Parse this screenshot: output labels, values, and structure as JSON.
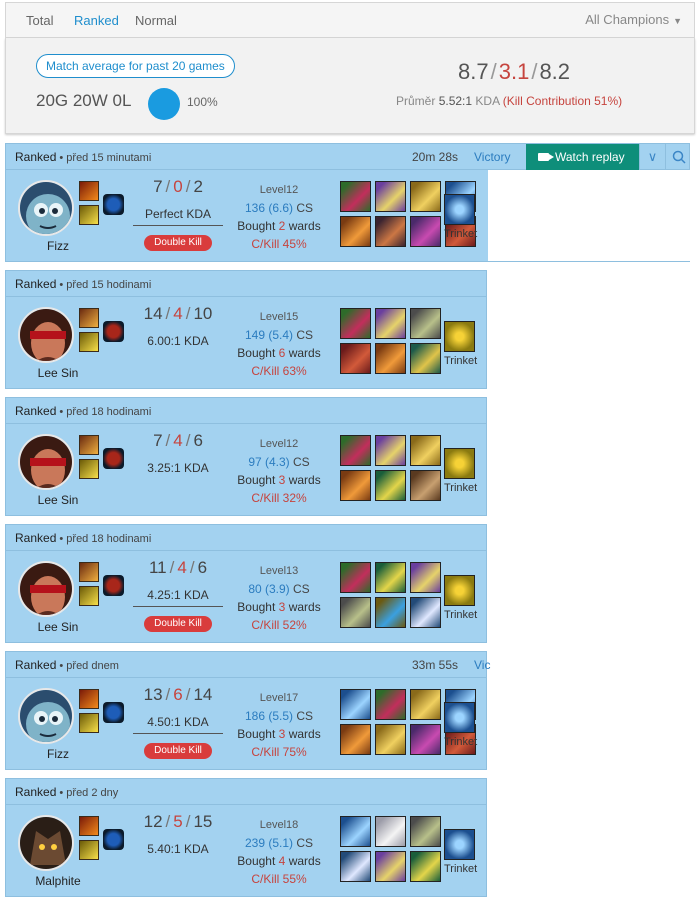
{
  "tabs": [
    {
      "label": "Total",
      "active": false
    },
    {
      "label": "Ranked",
      "active": true
    },
    {
      "label": "Normal",
      "active": false
    }
  ],
  "filter": {
    "label": "All Champions"
  },
  "summary": {
    "avg_label": "Match average for past 20 games",
    "record": "20G 20W 0L",
    "win_rate": "100%",
    "kda_k": "8.7",
    "kda_d": "3.1",
    "kda_a": "8.2",
    "sep": "/",
    "avg_label2": "Průměr",
    "kda_ratio": "5.52:1",
    "kda_word": "KDA",
    "kill_contribution": "(Kill Contribution 51%)"
  },
  "games": [
    {
      "type": "Ranked",
      "ago": "• před 15 minutami",
      "duration": "20m 28s",
      "result": "Victory",
      "champion": "Fizz",
      "portrait": "fizz",
      "spells": [
        "ignite",
        "flash"
      ],
      "rune": "blue",
      "k": "7",
      "d": "0",
      "a": "2",
      "ratio_value": "Perfect",
      "ratio_word": "KDA",
      "multikill": "Double Kill",
      "level": "Level12",
      "cs": "136 (6.6)",
      "cs_word": "CS",
      "wards_pre": "Bought",
      "wards_n": "2",
      "wards_post": "wards",
      "ckill": "C/Kill 45%",
      "items": [
        "green",
        "purple",
        "gold",
        "blue",
        "orange",
        "dark",
        "purple2",
        "red"
      ],
      "trinket": "blue",
      "trinket_label": "Trinket",
      "watch": "Watch replay",
      "show_watch": true
    },
    {
      "type": "Ranked",
      "ago": "• před 15 hodinami",
      "duration": "",
      "result": "",
      "champion": "Lee Sin",
      "portrait": "lee",
      "spells": [
        "smite",
        "flash"
      ],
      "rune": "red",
      "k": "14",
      "d": "4",
      "a": "10",
      "ratio_value": "6.00:1",
      "ratio_word": "KDA",
      "multikill": "",
      "level": "Level15",
      "cs": "149 (5.4)",
      "cs_word": "CS",
      "wards_pre": "Bought",
      "wards_n": "6",
      "wards_post": "wards",
      "ckill": "C/Kill 63%",
      "items": [
        "green",
        "purple",
        "gray",
        "yellow",
        "red",
        "orange",
        "teal"
      ],
      "trinket": "yellow",
      "trinket_label": "Trinket",
      "watch": "",
      "show_watch": false
    },
    {
      "type": "Ranked",
      "ago": "• před 18 hodinami",
      "duration": "",
      "result": "",
      "champion": "Lee Sin",
      "portrait": "lee",
      "spells": [
        "smite",
        "flash"
      ],
      "rune": "red",
      "k": "7",
      "d": "4",
      "a": "6",
      "ratio_value": "3.25:1",
      "ratio_word": "KDA",
      "multikill": "",
      "level": "Level12",
      "cs": "97 (4.3)",
      "cs_word": "CS",
      "wards_pre": "Bought",
      "wards_n": "3",
      "wards_post": "wards",
      "ckill": "C/Kill 32%",
      "items": [
        "green",
        "purple",
        "gold",
        "yellow",
        "orange",
        "green2",
        "brown"
      ],
      "trinket": "yellow",
      "trinket_label": "Trinket",
      "watch": "",
      "show_watch": false
    },
    {
      "type": "Ranked",
      "ago": "• před 18 hodinami",
      "duration": "",
      "result": "",
      "champion": "Lee Sin",
      "portrait": "lee",
      "spells": [
        "smite",
        "flash"
      ],
      "rune": "red",
      "k": "11",
      "d": "4",
      "a": "6",
      "ratio_value": "4.25:1",
      "ratio_word": "KDA",
      "multikill": "Double Kill",
      "level": "Level13",
      "cs": "80 (3.9)",
      "cs_word": "CS",
      "wards_pre": "Bought",
      "wards_n": "3",
      "wards_post": "wards",
      "ckill": "C/Kill 52%",
      "items": [
        "green",
        "green2",
        "purple",
        "yellow",
        "gray",
        "gold2",
        "blue2"
      ],
      "trinket": "yellow",
      "trinket_label": "Trinket",
      "watch": "",
      "show_watch": false
    },
    {
      "type": "Ranked",
      "ago": "• před dnem",
      "duration": "33m 55s",
      "result": "Vic",
      "champion": "Fizz",
      "portrait": "fizz",
      "spells": [
        "ignite",
        "flash"
      ],
      "rune": "blue",
      "k": "13",
      "d": "6",
      "a": "14",
      "ratio_value": "4.50:1",
      "ratio_word": "KDA",
      "multikill": "Double Kill",
      "level": "Level17",
      "cs": "186 (5.5)",
      "cs_word": "CS",
      "wards_pre": "Bought",
      "wards_n": "3",
      "wards_post": "wards",
      "ckill": "C/Kill 75%",
      "items": [
        "blue",
        "green",
        "gold",
        "blue",
        "orange",
        "gold",
        "purple2",
        "red"
      ],
      "trinket": "blue",
      "trinket_label": "Trinket",
      "watch": "",
      "show_watch": false
    },
    {
      "type": "Ranked",
      "ago": "• před 2 dny",
      "duration": "",
      "result": "",
      "champion": "Malphite",
      "portrait": "malph",
      "spells": [
        "ignite",
        "flash"
      ],
      "rune": "blue",
      "k": "12",
      "d": "5",
      "a": "15",
      "ratio_value": "5.40:1",
      "ratio_word": "KDA",
      "multikill": "",
      "level": "Level18",
      "cs": "239 (5.1)",
      "cs_word": "CS",
      "wards_pre": "Bought",
      "wards_n": "4",
      "wards_post": "wards",
      "ckill": "C/Kill 55%",
      "items": [
        "blue",
        "white",
        "gray",
        "blue",
        "blue2",
        "purple",
        "green2"
      ],
      "trinket": "blue",
      "trinket_label": "Trinket",
      "watch": "",
      "show_watch": false
    }
  ]
}
